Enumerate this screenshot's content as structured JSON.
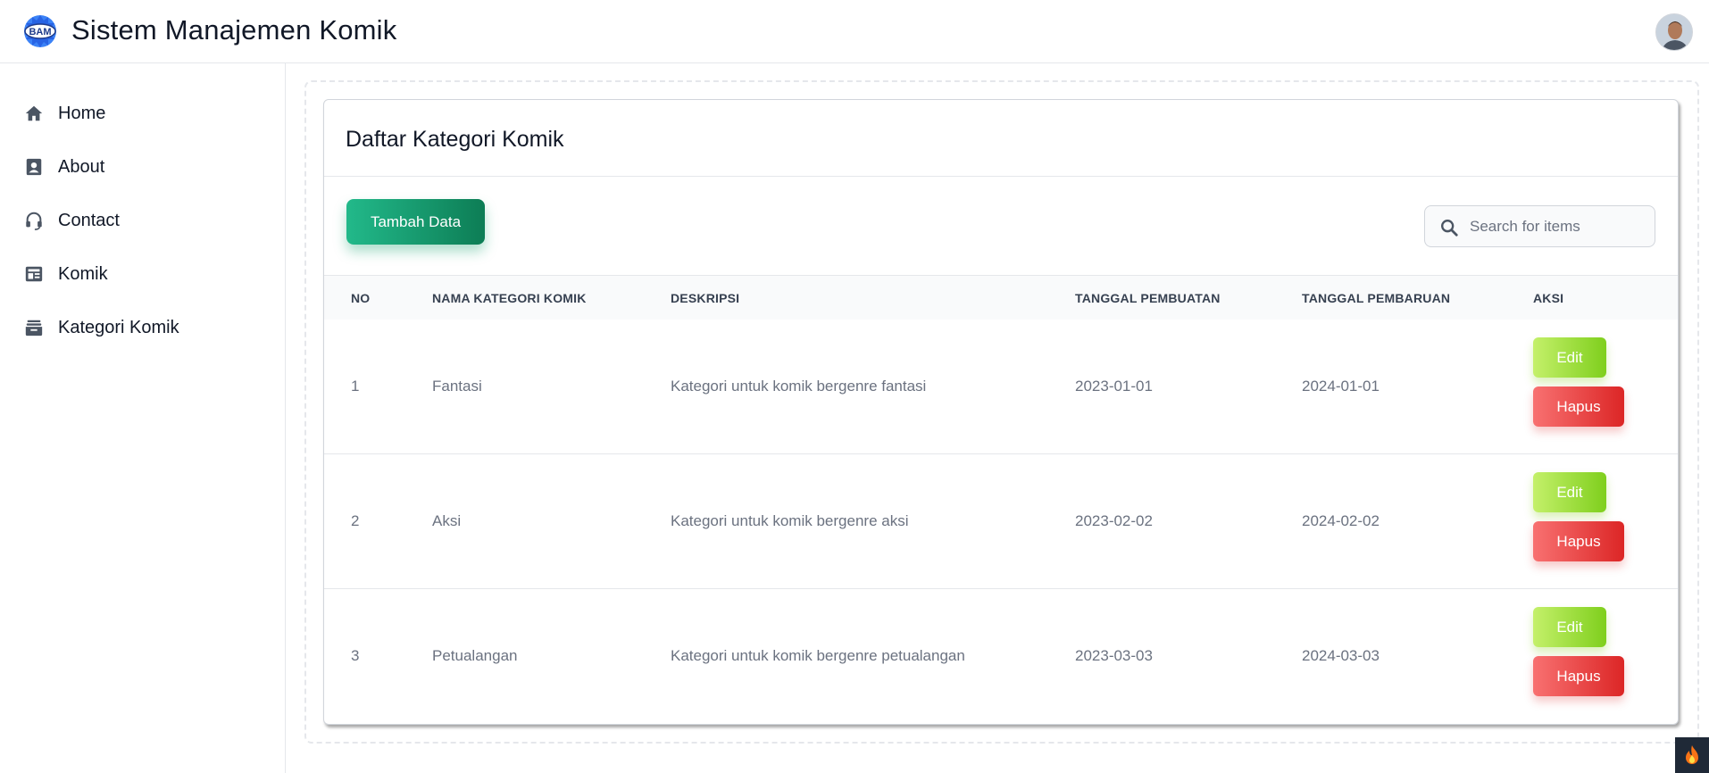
{
  "header": {
    "app_title": "Sistem Manajemen Komik",
    "logo_text": "BAM"
  },
  "sidebar": {
    "items": [
      {
        "label": "Home",
        "icon": "home-icon"
      },
      {
        "label": "About",
        "icon": "contact-card-icon"
      },
      {
        "label": "Contact",
        "icon": "headset-icon"
      },
      {
        "label": "Komik",
        "icon": "newspaper-icon"
      },
      {
        "label": "Kategori Komik",
        "icon": "inbox-tray-icon"
      }
    ]
  },
  "main": {
    "card_title": "Daftar Kategori Komik",
    "add_button_label": "Tambah Data",
    "search": {
      "placeholder": "Search for items",
      "value": ""
    },
    "table": {
      "columns": [
        "NO",
        "NAMA KATEGORI KOMIK",
        "DESKRIPSI",
        "TANGGAL PEMBUATAN",
        "TANGGAL PEMBARUAN",
        "AKSI"
      ],
      "rows": [
        {
          "no": "1",
          "name": "Fantasi",
          "description": "Kategori untuk komik bergenre fantasi",
          "created": "2023-01-01",
          "updated": "2024-01-01"
        },
        {
          "no": "2",
          "name": "Aksi",
          "description": "Kategori untuk komik bergenre aksi",
          "created": "2023-02-02",
          "updated": "2024-02-02"
        },
        {
          "no": "3",
          "name": "Petualangan",
          "description": "Kategori untuk komik bergenre petualangan",
          "created": "2023-03-03",
          "updated": "2024-03-03"
        }
      ],
      "edit_label": "Edit",
      "delete_label": "Hapus"
    }
  },
  "colors": {
    "primary_button": "#0f9d6b",
    "edit_button": "#84cc16",
    "delete_button": "#ef4444"
  }
}
